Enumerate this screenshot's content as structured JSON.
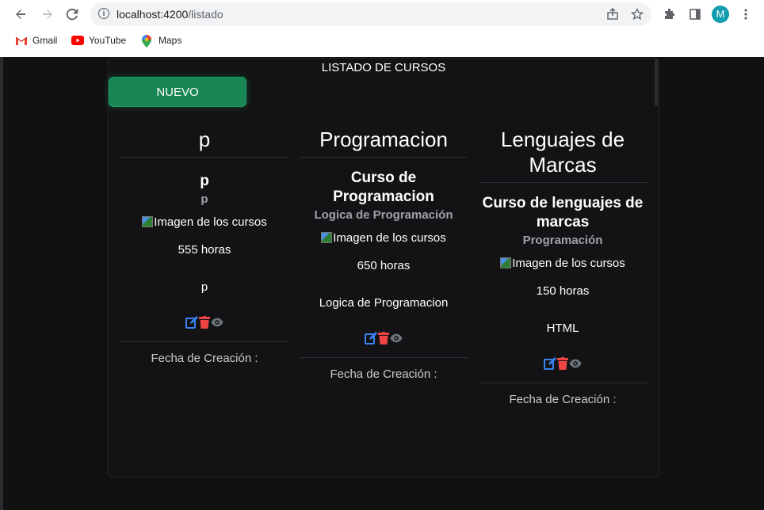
{
  "browser": {
    "url_host": "localhost:4200",
    "url_path": "/listado",
    "avatar_letter": "M",
    "bookmarks": [
      {
        "label": "Gmail"
      },
      {
        "label": "YouTube"
      },
      {
        "label": "Maps"
      }
    ]
  },
  "page": {
    "title": "LISTADO DE CURSOS",
    "new_button": "NUEVO"
  },
  "cards": [
    {
      "header": "p",
      "title": "p",
      "subtitle": "p",
      "image_alt": "Imagen de los cursos",
      "hours": "555 horas",
      "description": "p",
      "footer": "Fecha de Creación :"
    },
    {
      "header": "Programacion",
      "title": "Curso de Programacion",
      "subtitle": "Logica de Programación",
      "image_alt": "Imagen de los cursos",
      "hours": "650 horas",
      "description": "Logica de Programacion",
      "footer": "Fecha de Creación :"
    },
    {
      "header": "Lenguajes de Marcas",
      "title": "Curso de lenguajes de marcas",
      "subtitle": "Programación",
      "image_alt": "Imagen de los cursos",
      "hours": "150 horas",
      "description": "HTML",
      "footer": "Fecha de Creación :"
    }
  ],
  "colors": {
    "edit": "#3b82f6",
    "delete": "#ef4444",
    "view": "#6c757d",
    "primary_button": "#198754"
  }
}
